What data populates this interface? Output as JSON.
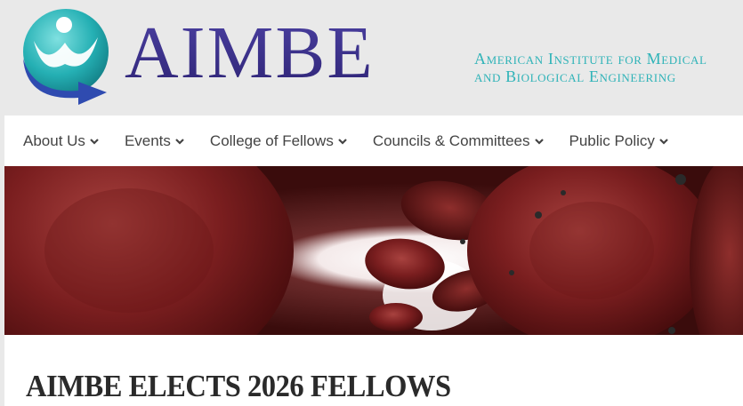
{
  "brand": {
    "wordmark": "AIMBE",
    "org_name_line1": "American Institute for Medical",
    "org_name_line2": "and Biological Engineering",
    "colors": {
      "teal": "#2fb3b8",
      "indigo": "#3a2d86",
      "arrow_blue": "#2f4bb0"
    }
  },
  "nav": {
    "items": [
      {
        "label": "About Us",
        "icon": "chevron-down-icon"
      },
      {
        "label": "Events",
        "icon": "chevron-down-icon"
      },
      {
        "label": "College of Fellows",
        "icon": "chevron-down-icon"
      },
      {
        "label": "Councils & Committees",
        "icon": "chevron-down-icon"
      },
      {
        "label": "Public Policy",
        "icon": "chevron-down-icon"
      }
    ]
  },
  "hero": {
    "image": "red-blood-cells-banner"
  },
  "article": {
    "headline": "AIMBE ELECTS 2026 FELLOWS"
  }
}
